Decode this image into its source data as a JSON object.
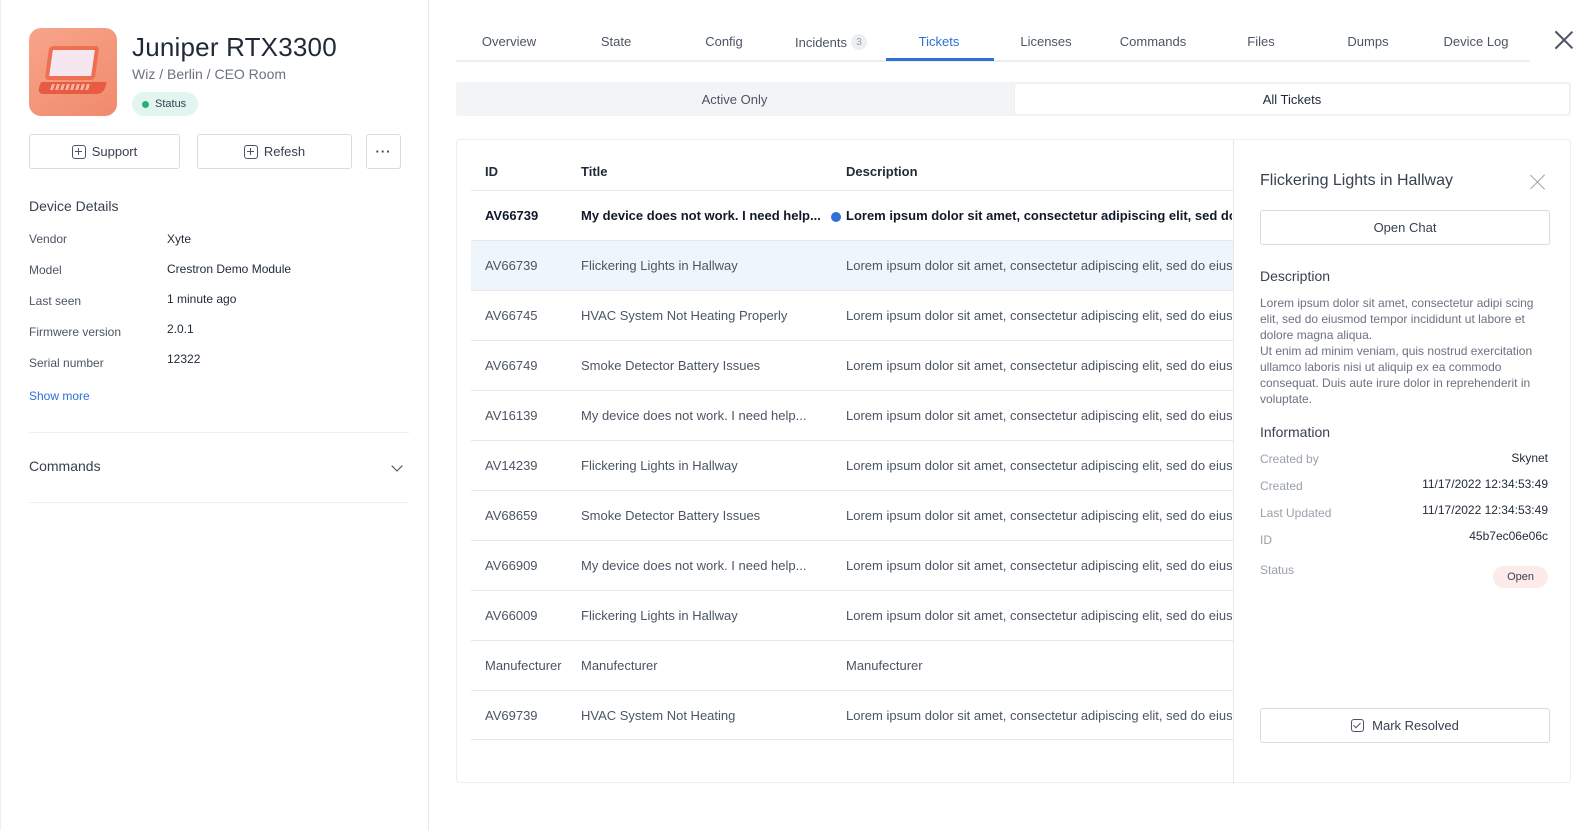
{
  "device": {
    "name": "Juniper RTX3300",
    "path": "Wiz / Berlin / CEO Room",
    "status_label": "Status",
    "thumbnail_icon": "laptop-icon"
  },
  "actions": {
    "support_label": "Support",
    "refresh_label": "Refesh",
    "more_label": "···"
  },
  "device_details": {
    "title": "Device Details",
    "rows": [
      {
        "label": "Vendor",
        "value": "Xyte"
      },
      {
        "label": "Model",
        "value": "Crestron Demo Module"
      },
      {
        "label": "Last seen",
        "value": "1 minute ago"
      },
      {
        "label": "Firmwere version",
        "value": "2.0.1"
      },
      {
        "label": "Serial number",
        "value": "12322"
      }
    ],
    "show_more": "Show more"
  },
  "commands_section": {
    "title": "Commands"
  },
  "tabs": [
    {
      "label": "Overview"
    },
    {
      "label": "State"
    },
    {
      "label": "Config"
    },
    {
      "label": "Incidents",
      "badge": "3"
    },
    {
      "label": "Tickets",
      "active": true
    },
    {
      "label": "Licenses"
    },
    {
      "label": "Commands"
    },
    {
      "label": "Files"
    },
    {
      "label": "Dumps"
    },
    {
      "label": "Device Log"
    }
  ],
  "filter": {
    "active_only": "Active Only",
    "all_tickets": "All Tickets",
    "selected": "All Tickets"
  },
  "table": {
    "headers": {
      "id": "ID",
      "title": "Title",
      "description": "Description"
    },
    "rows": [
      {
        "id": "AV66739",
        "title": "My device does not work. I need help...",
        "description": "Lorem ipsum dolor sit amet, consectetur adipiscing elit, sed do eiusm.",
        "unread": true
      },
      {
        "id": "AV66739",
        "title": "Flickering Lights in Hallway",
        "description": "Lorem ipsum dolor sit amet, consectetur adipiscing elit, sed do eiusm.",
        "selected": true
      },
      {
        "id": "AV66745",
        "title": "HVAC System Not Heating Properly",
        "description": "Lorem ipsum dolor sit amet, consectetur adipiscing elit, sed do eiusm."
      },
      {
        "id": "AV66749",
        "title": "Smoke Detector Battery Issues",
        "description": "Lorem ipsum dolor sit amet, consectetur adipiscing elit, sed do eiusm."
      },
      {
        "id": "AV16139",
        "title": "My device does not work. I need help...",
        "description": "Lorem ipsum dolor sit amet, consectetur adipiscing elit, sed do eiusm."
      },
      {
        "id": "AV14239",
        "title": "Flickering Lights in Hallway",
        "description": "Lorem ipsum dolor sit amet, consectetur adipiscing elit, sed do eiusm."
      },
      {
        "id": "AV68659",
        "title": "Smoke Detector Battery Issues",
        "description": "Lorem ipsum dolor sit amet, consectetur adipiscing elit, sed do eiusm."
      },
      {
        "id": "AV66909",
        "title": "My device does not work. I need help...",
        "description": "Lorem ipsum dolor sit amet, consectetur adipiscing elit, sed do eiusm."
      },
      {
        "id": "AV66009",
        "title": "Flickering Lights in Hallway",
        "description": "Lorem ipsum dolor sit amet, consectetur adipiscing elit, sed do eiusm."
      },
      {
        "id": "Manufecturer",
        "title": "Manufecturer",
        "description": "Manufecturer"
      },
      {
        "id": "AV69739",
        "title": "HVAC System Not Heating",
        "description": "Lorem ipsum dolor sit amet, consectetur adipiscing elit, sed do eiusm."
      }
    ]
  },
  "ticket_detail": {
    "title": "Flickering Lights in Hallway",
    "open_chat": "Open Chat",
    "description_title": "Description",
    "description": "Lorem ipsum dolor sit amet, consectetur adipi scing elit, sed do eiusmod tempor incididunt ut labore et dolore magna aliqua.\nUt enim ad minim veniam, quis nostrud exercitation ullamco laboris nisi ut aliquip ex ea commodo consequat. Duis aute irure dolor in reprehenderit in voluptate.",
    "information_title": "Information",
    "info": [
      {
        "label": "Created by",
        "value": "Skynet"
      },
      {
        "label": "Created",
        "value": "11/17/2022 12:34:53:49"
      },
      {
        "label": "Last Updated",
        "value": "11/17/2022 12:34:53:49"
      },
      {
        "label": "ID",
        "value": "45b7ec06e06c"
      },
      {
        "label": "Status",
        "value": "Open"
      }
    ],
    "mark_resolved": "Mark Resolved"
  },
  "colors": {
    "accent": "#2f6fd6",
    "status_green": "#22b07d",
    "selected_row": "#eef5fb",
    "open_badge": "#fdeaea"
  }
}
